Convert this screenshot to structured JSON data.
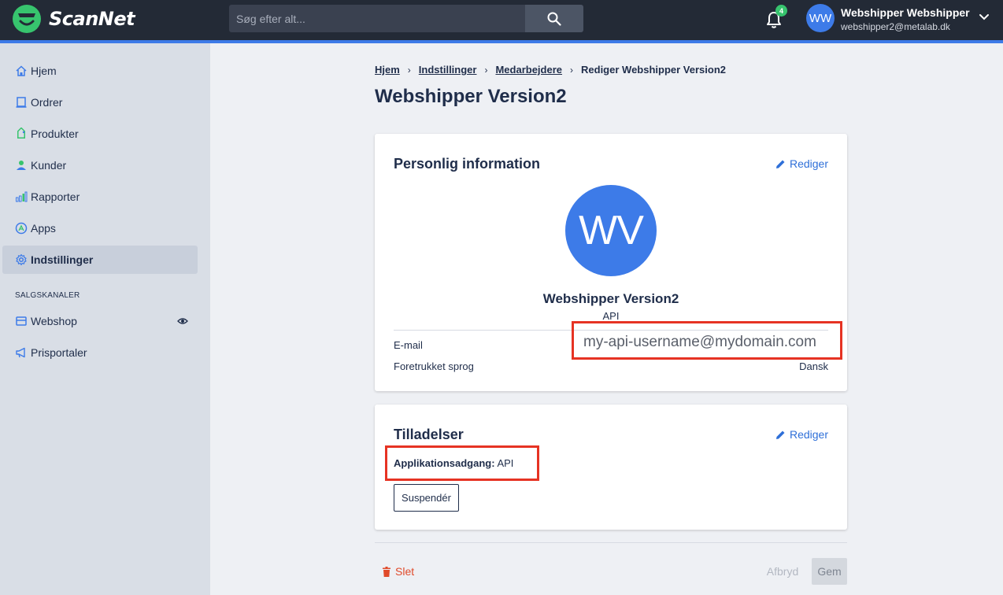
{
  "app": {
    "brand": "ScanNet",
    "brand_color": "#37c46e",
    "accent_color": "#3d7be8",
    "highlight_color": "#e63323"
  },
  "header": {
    "search": {
      "placeholder": "Søg efter alt..."
    },
    "notifications": {
      "count": "4"
    },
    "user": {
      "initials": "WW",
      "name": "Webshipper Webshipper",
      "email": "webshipper2@metalab.dk"
    }
  },
  "sidebar": {
    "items": [
      {
        "label": "Hjem",
        "icon": "home-icon"
      },
      {
        "label": "Ordrer",
        "icon": "orders-icon"
      },
      {
        "label": "Produkter",
        "icon": "tag-icon"
      },
      {
        "label": "Kunder",
        "icon": "user-icon"
      },
      {
        "label": "Rapporter",
        "icon": "bar-chart-icon"
      },
      {
        "label": "Apps",
        "icon": "apps-icon"
      },
      {
        "label": "Indstillinger",
        "icon": "gear-icon",
        "active": true
      }
    ],
    "section_title": "SALGSKANALER",
    "channels": [
      {
        "label": "Webshop",
        "icon": "store-icon"
      },
      {
        "label": "Prisportaler",
        "icon": "megaphone-icon"
      }
    ]
  },
  "main": {
    "breadcrumb": [
      "Hjem",
      "Indstillinger",
      "Medarbejdere"
    ],
    "breadcrumb_current": "Rediger Webshipper Version2",
    "title": "Webshipper Version2",
    "personal": {
      "title": "Personlig information",
      "edit_label": "Rediger",
      "avatar_initials": "WV",
      "name": "Webshipper Version2",
      "role": "API",
      "email_label": "E-mail",
      "email_value": "my-api-username@mydomain.com",
      "language_label": "Foretrukket sprog",
      "language_value": "Dansk"
    },
    "permissions": {
      "title": "Tilladelser",
      "edit_label": "Rediger",
      "access_label": "Applikationsadgang:",
      "access_value": "API",
      "suspend_label": "Suspendér"
    },
    "footer": {
      "delete_label": "Slet",
      "cancel_label": "Afbryd",
      "save_label": "Gem"
    }
  }
}
